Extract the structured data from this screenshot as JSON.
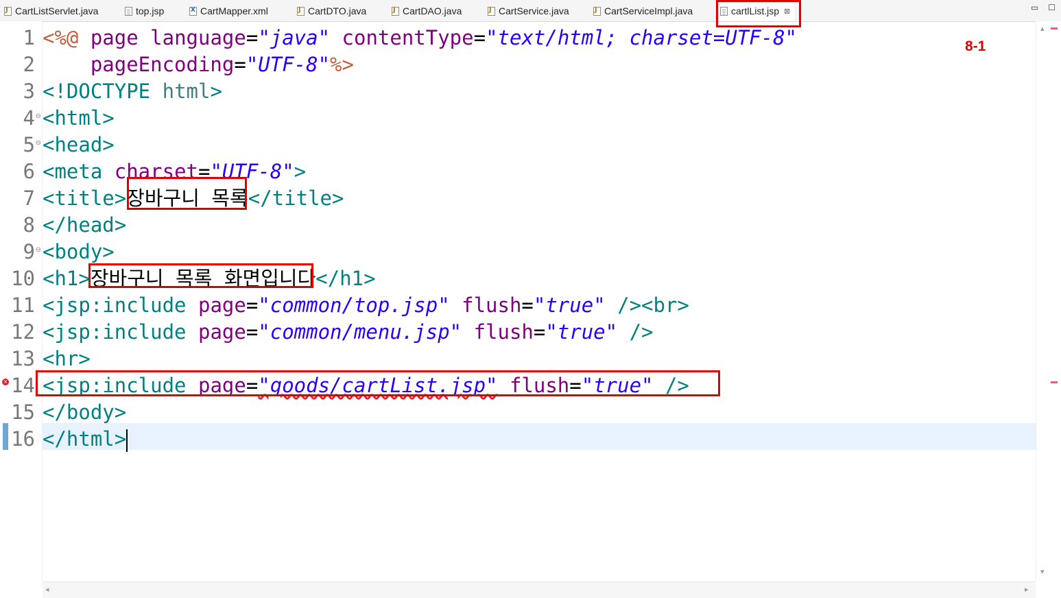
{
  "tabs": [
    {
      "label": "CartListServlet.java",
      "icon": "java-file-icon"
    },
    {
      "label": "top.jsp",
      "icon": "jsp-file-icon"
    },
    {
      "label": "CartMapper.xml",
      "icon": "xml-file-icon"
    },
    {
      "label": "CartDTO.java",
      "icon": "java-file-icon"
    },
    {
      "label": "CartDAO.java",
      "icon": "java-file-icon"
    },
    {
      "label": "CartService.java",
      "icon": "java-file-icon"
    },
    {
      "label": "CartServiceImpl.java",
      "icon": "java-file-icon"
    },
    {
      "label": "cartlList.jsp",
      "icon": "jsp-file-icon",
      "active": true,
      "close": "⊠"
    }
  ],
  "window_buttons": {
    "minimize": "▭",
    "maximize": "☐"
  },
  "annotation": "8-1",
  "line_numbers": [
    "1",
    "2",
    "3",
    "4",
    "5",
    "6",
    "7",
    "8",
    "9",
    "10",
    "11",
    "12",
    "13",
    "14",
    "15",
    "16"
  ],
  "code": {
    "l1": {
      "a": "<%@",
      "b": " page ",
      "c": "language",
      "d": "=",
      "e": "\"java\"",
      "f": " contentType",
      "g": "=",
      "h": "\"text/html; charset=UTF-8\""
    },
    "l2": {
      "a": "    pageEncoding",
      "b": "=",
      "c": "\"UTF-8\"",
      "d": "%>"
    },
    "l3": {
      "a": "<!DOCTYPE ",
      "b": "html",
      "c": ">"
    },
    "l4": {
      "a": "<html>"
    },
    "l5": {
      "a": "<head>"
    },
    "l6": {
      "a": "<meta ",
      "b": "charset",
      "c": "=",
      "d": "\"UTF-8\"",
      "e": ">"
    },
    "l7": {
      "a": "<title>",
      "b": "장바구니 목록",
      "c": "</title>"
    },
    "l8": {
      "a": "</head>"
    },
    "l9": {
      "a": "<body>"
    },
    "l10": {
      "a": "<h1>",
      "b": "장바구니 목록 화면입니다",
      "c": "</h1>"
    },
    "l11": {
      "a": "<jsp:include ",
      "b": "page",
      "c": "=",
      "d": "\"common/top.jsp\"",
      "e": " flush",
      "f": "=",
      "g": "\"true\"",
      "h": " /><br>"
    },
    "l12": {
      "a": "<jsp:include ",
      "b": "page",
      "c": "=",
      "d": "\"common/menu.jsp\"",
      "e": " flush",
      "f": "=",
      "g": "\"true\"",
      "h": " />"
    },
    "l13": {
      "a": "<hr>"
    },
    "l14": {
      "a": "<jsp:include ",
      "b": "page",
      "c": "=",
      "d": "\"goods/cartList.jsp\"",
      "e": " flush",
      "f": "=",
      "g": "\"true\"",
      "h": " />"
    },
    "l15": {
      "a": "</body>"
    },
    "l16": {
      "a": "</html>"
    }
  },
  "gutter_markers": {
    "error_line": "14",
    "error_symbol": "×",
    "fold_symbol": "⊖"
  },
  "colors": {
    "highlight_box": "#e00000",
    "directive": "#bf5f3f",
    "attribute": "#7f007f",
    "value": "#2a00ff",
    "tag": "#008080"
  }
}
